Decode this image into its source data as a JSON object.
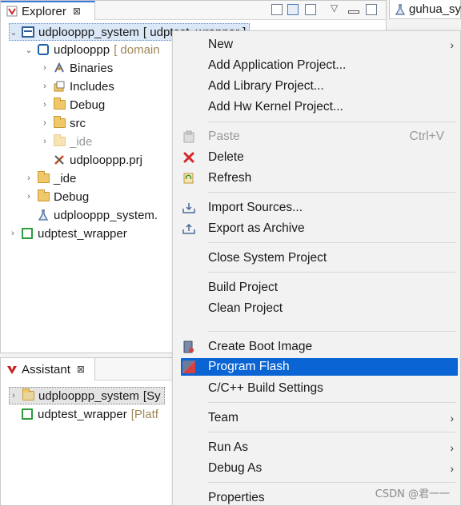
{
  "explorer": {
    "tab_label": "Explorer",
    "tab_close": "⊠",
    "right_tab_label": "guhua_sy",
    "tree": [
      {
        "twisty": "⌄",
        "label": "udplooppp_system",
        "suffix": "[ udptest_wrapper ]",
        "icon": "system-icon",
        "selected": true
      },
      {
        "twisty": "⌄",
        "label": "udplooppp",
        "suffix": "[ domain",
        "icon": "domain-chip-icon"
      },
      {
        "twisty": "›",
        "label": "Binaries",
        "icon": "binaries-icon"
      },
      {
        "twisty": "›",
        "label": "Includes",
        "icon": "includes-icon"
      },
      {
        "twisty": "›",
        "label": "Debug",
        "icon": "folder-icon"
      },
      {
        "twisty": "›",
        "label": "src",
        "icon": "folder-icon"
      },
      {
        "twisty": "›",
        "label": "_ide",
        "icon": "folder-icon",
        "faded": true
      },
      {
        "twisty": "",
        "label": "udplooppp.prj",
        "icon": "project-file-icon"
      },
      {
        "twisty": "›",
        "label": "_ide",
        "icon": "folder-icon"
      },
      {
        "twisty": "›",
        "label": "Debug",
        "icon": "folder-icon"
      },
      {
        "twisty": "",
        "label": "udplooppp_system.",
        "icon": "flask-icon"
      },
      {
        "twisty": "›",
        "label": "udptest_wrapper",
        "icon": "platform-icon"
      }
    ]
  },
  "assistant": {
    "tab_label": "Assistant",
    "tab_close": "⊠",
    "tree": [
      {
        "twisty": "›",
        "label": "udplooppp_system",
        "suffix": "[Sy",
        "icon": "system-folder-icon",
        "selected": true
      },
      {
        "twisty": "",
        "label": "udptest_wrapper",
        "suffix": "[Platf",
        "icon": "platform-icon"
      }
    ]
  },
  "context_menu": {
    "items": [
      {
        "label": "New",
        "submenu": true
      },
      {
        "label": "Add Application Project..."
      },
      {
        "label": "Add Library Project..."
      },
      {
        "label": "Add Hw Kernel Project..."
      },
      {
        "label": "Paste",
        "shortcut": "Ctrl+V",
        "disabled": true,
        "icon": "paste-icon"
      },
      {
        "label": "Delete",
        "icon": "delete-icon"
      },
      {
        "label": "Refresh",
        "icon": "refresh-icon"
      },
      {
        "label": "Import Sources...",
        "icon": "import-icon"
      },
      {
        "label": "Export as Archive",
        "icon": "export-icon"
      },
      {
        "label": "Close System Project"
      },
      {
        "label": "Build Project"
      },
      {
        "label": "Clean Project"
      },
      {
        "label": "Create Boot Image",
        "icon": "boot-image-icon"
      },
      {
        "label": "Program Flash",
        "icon": "program-flash-icon",
        "highlighted": true
      },
      {
        "label": "C/C++ Build Settings"
      },
      {
        "label": "Team",
        "submenu": true
      },
      {
        "label": "Run As",
        "submenu": true
      },
      {
        "label": "Debug As",
        "submenu": true
      },
      {
        "label": "Properties"
      }
    ],
    "submenu_arrow": "›"
  },
  "watermark": "CSDN @君一一",
  "colors": {
    "accent": "#0a64d4",
    "delete_red": "#d62828",
    "folder": "#f0c86a",
    "platform_green": "#2d9c3a"
  }
}
